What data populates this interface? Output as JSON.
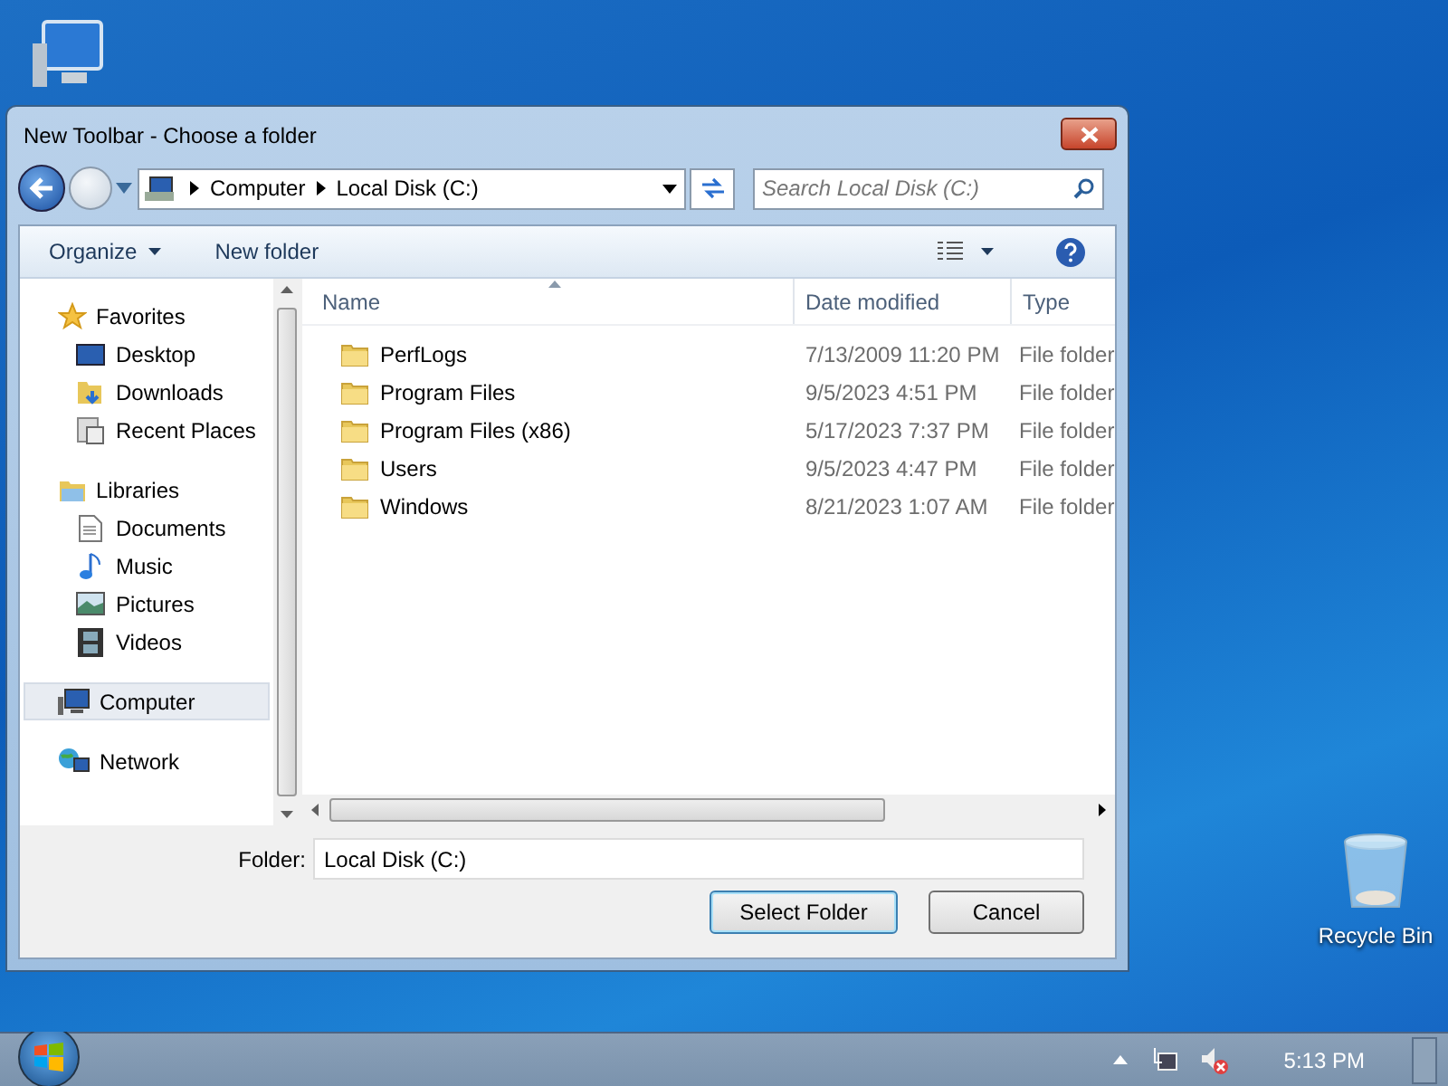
{
  "dialog": {
    "title": "New Toolbar - Choose a folder",
    "breadcrumb": [
      "Computer",
      "Local Disk (C:)"
    ],
    "search": {
      "placeholder": "Search Local Disk (C:)"
    },
    "toolbar": {
      "organize": "Organize",
      "new_folder": "New folder"
    },
    "nav": [
      {
        "label": "Favorites",
        "selected": false,
        "children": [
          {
            "label": "Desktop",
            "selected": false
          },
          {
            "label": "Downloads",
            "selected": false
          },
          {
            "label": "Recent Places",
            "selected": false
          }
        ]
      },
      {
        "label": "Libraries",
        "selected": false,
        "children": [
          {
            "label": "Documents",
            "selected": false
          },
          {
            "label": "Music",
            "selected": false
          },
          {
            "label": "Pictures",
            "selected": false
          },
          {
            "label": "Videos",
            "selected": false
          }
        ]
      },
      {
        "label": "Computer",
        "selected": true
      },
      {
        "label": "Network",
        "selected": false
      }
    ],
    "columns": [
      "Name",
      "Date modified",
      "Type"
    ],
    "rows": [
      {
        "name": "PerfLogs",
        "date": "7/13/2009 11:20 PM",
        "type": "File folder"
      },
      {
        "name": "Program Files",
        "date": "9/5/2023 4:51 PM",
        "type": "File folder"
      },
      {
        "name": "Program Files (x86)",
        "date": "5/17/2023 7:37 PM",
        "type": "File folder"
      },
      {
        "name": "Users",
        "date": "9/5/2023 4:47 PM",
        "type": "File folder"
      },
      {
        "name": "Windows",
        "date": "8/21/2023 1:07 AM",
        "type": "File folder"
      }
    ],
    "folder_label": "Folder:",
    "folder_value": "Local Disk (C:)",
    "buttons": [
      {
        "label": "Select Folder",
        "default": true
      },
      {
        "label": "Cancel",
        "default": false
      }
    ]
  },
  "desktop": {
    "icons": [
      {
        "label": "Recycle Bin"
      }
    ]
  },
  "taskbar": {
    "clock": "5:13 PM"
  }
}
